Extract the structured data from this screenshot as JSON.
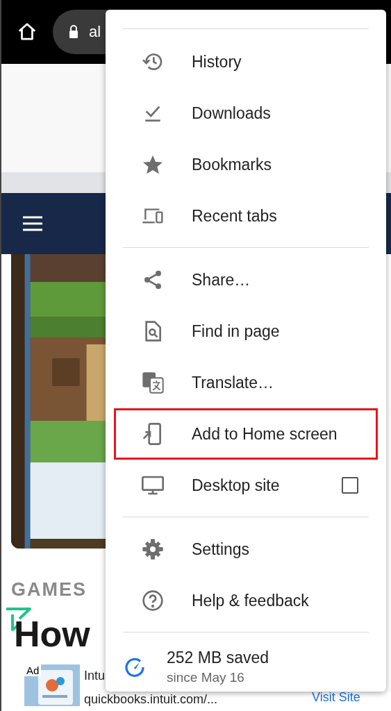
{
  "toolbar": {
    "url": "al"
  },
  "page": {
    "category": "GAMES",
    "headline": "How",
    "ad": {
      "badge": "Ad",
      "title": "Intu",
      "url": "quickbooks.intuit.com/...",
      "action": "Visit Site"
    }
  },
  "menu": {
    "sections": [
      {
        "items": [
          {
            "label": "History"
          },
          {
            "label": "Downloads"
          },
          {
            "label": "Bookmarks"
          },
          {
            "label": "Recent tabs"
          }
        ]
      },
      {
        "items": [
          {
            "label": "Share…"
          },
          {
            "label": "Find in page"
          },
          {
            "label": "Translate…"
          },
          {
            "label": "Add to Home screen",
            "highlighted": true
          },
          {
            "label": "Desktop site",
            "kind": "checkbox",
            "checked": false
          }
        ]
      },
      {
        "items": [
          {
            "label": "Settings"
          },
          {
            "label": "Help & feedback"
          }
        ]
      }
    ],
    "savings": {
      "amount": "252 MB saved",
      "since": "since May 16"
    }
  }
}
